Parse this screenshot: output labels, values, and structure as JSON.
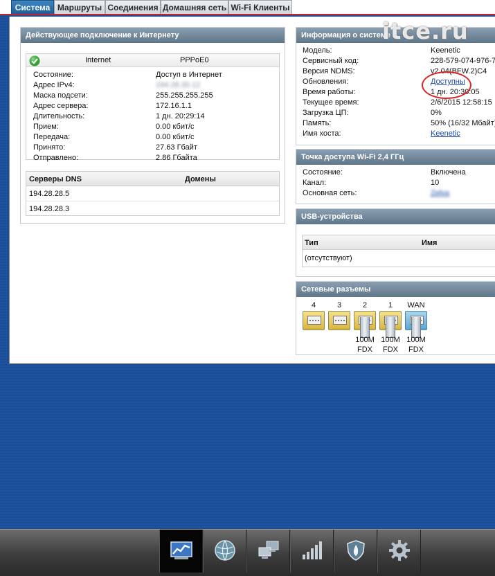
{
  "tabs": [
    {
      "label": "Система",
      "active": true
    },
    {
      "label": "Маршруты",
      "active": false
    },
    {
      "label": "Соединения",
      "active": false
    },
    {
      "label": "Домашняя сеть",
      "active": false
    },
    {
      "label": "Wi-Fi Клиенты",
      "active": false
    }
  ],
  "internet": {
    "title": "Действующее подключение к Интернету",
    "name": "Internet",
    "iface": "PPPoE0",
    "rows": [
      {
        "label": "Состояние:",
        "value": "Доступ в Интернет"
      },
      {
        "label": "Адрес IPv4:",
        "value": "194.28.30.12"
      },
      {
        "label": "Маска подсети:",
        "value": "255.255.255.255"
      },
      {
        "label": "Адрес сервера:",
        "value": "172.16.1.1"
      },
      {
        "label": "Длительность:",
        "value": "1 дн. 20:29:14"
      },
      {
        "label": "Прием:",
        "value": "0.00 кбит/с"
      },
      {
        "label": "Передача:",
        "value": "0.00 кбит/с"
      },
      {
        "label": "Принято:",
        "value": "27.63 Гбайт"
      },
      {
        "label": "Отправлено:",
        "value": "2.86 Гбайта"
      }
    ],
    "dns": {
      "col_servers": "Серверы DNS",
      "col_domains": "Домены",
      "servers": [
        "194.28.28.5",
        "194.28.28.3"
      ]
    }
  },
  "sysinfo": {
    "title": "Информация о системе",
    "rows": [
      {
        "label": "Модель:",
        "value": "Keenetic"
      },
      {
        "label": "Сервисный код:",
        "value": "228-579-074-976-7"
      },
      {
        "label": "Версия NDMS:",
        "value": "v2.04(BFW.2)C4"
      },
      {
        "label": "Обновления:",
        "value": "Доступны",
        "link": true
      },
      {
        "label": "Время работы:",
        "value": "1 дн. 20:30:05"
      },
      {
        "label": "Текущее время:",
        "value": "2/6/2015 12:58:15"
      },
      {
        "label": "Загрузка ЦП:",
        "value": "0%"
      },
      {
        "label": "Память:",
        "value": "50% (16/32 Мбайт)"
      },
      {
        "label": "Имя хоста:",
        "value": "Keenetic",
        "link": true
      }
    ]
  },
  "wifi": {
    "title": "Точка доступа Wi-Fi 2,4 ГГц",
    "rows": [
      {
        "label": "Состояние:",
        "value": "Включена"
      },
      {
        "label": "Канал:",
        "value": "10"
      },
      {
        "label": "Основная сеть:",
        "value": "Zelva"
      }
    ]
  },
  "usb": {
    "title": "USB-устройства",
    "col_type": "Тип",
    "col_name": "Имя",
    "empty": "(отсутствуют)"
  },
  "ports": {
    "title": "Сетевые разъемы",
    "items": [
      {
        "label": "4",
        "kind": "lan",
        "connected": false,
        "speed": "",
        "duplex": ""
      },
      {
        "label": "3",
        "kind": "lan",
        "connected": false,
        "speed": "",
        "duplex": ""
      },
      {
        "label": "2",
        "kind": "lan",
        "connected": true,
        "speed": "100M",
        "duplex": "FDX"
      },
      {
        "label": "1",
        "kind": "lan",
        "connected": true,
        "speed": "100M",
        "duplex": "FDX"
      },
      {
        "label": "WAN",
        "kind": "wan",
        "connected": true,
        "speed": "100M",
        "duplex": "FDX"
      }
    ]
  },
  "watermark": "itce.ru",
  "dock": [
    {
      "icon": "monitor-chart-icon",
      "active": true
    },
    {
      "icon": "globe-icon",
      "active": false
    },
    {
      "icon": "network-computers-icon",
      "active": false
    },
    {
      "icon": "signal-bars-icon",
      "active": false
    },
    {
      "icon": "shield-icon",
      "active": false
    },
    {
      "icon": "gear-icon",
      "active": false
    }
  ],
  "colors": {
    "tab_active": "#2a6aa6",
    "header": "#6e8497",
    "background": "#1c509b",
    "accent_red": "#c0282d"
  }
}
